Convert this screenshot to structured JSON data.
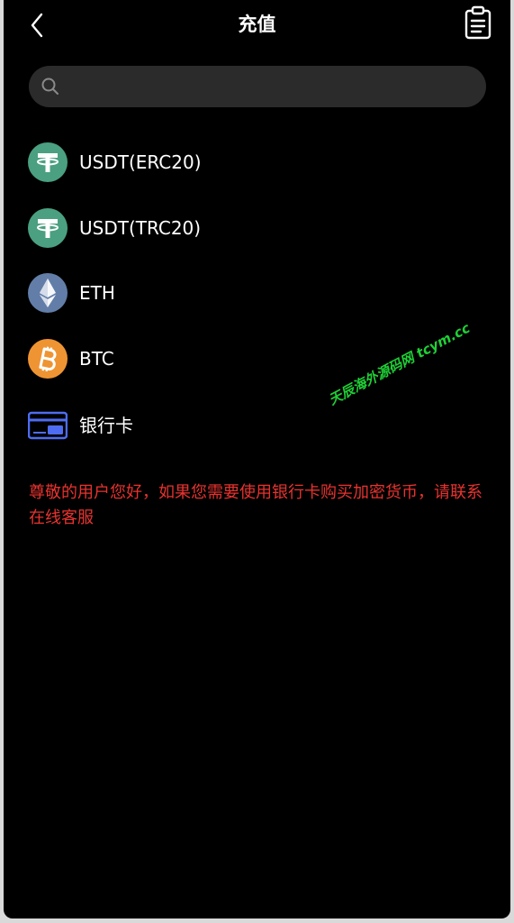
{
  "header": {
    "title": "充值"
  },
  "search": {
    "placeholder": ""
  },
  "currencies": [
    {
      "label": "USDT(ERC20)",
      "icon": "tether-icon"
    },
    {
      "label": "USDT(TRC20)",
      "icon": "tether-icon"
    },
    {
      "label": "ETH",
      "icon": "ethereum-icon"
    },
    {
      "label": "BTC",
      "icon": "bitcoin-icon"
    },
    {
      "label": "银行卡",
      "icon": "bank-card-icon"
    }
  ],
  "notice": {
    "text": "尊敬的用户您好，如果您需要使用银行卡购买加密货币，请联系在线客服"
  },
  "watermark": {
    "text": "天辰海外源码网 tcym.cc"
  },
  "colors": {
    "tether": "#4aa080",
    "ethereum": "#627ea8",
    "bitcoin": "#ef9433",
    "bank_card": "#4e6cf2",
    "notice": "#e8332f",
    "watermark": "#1fcf36"
  }
}
